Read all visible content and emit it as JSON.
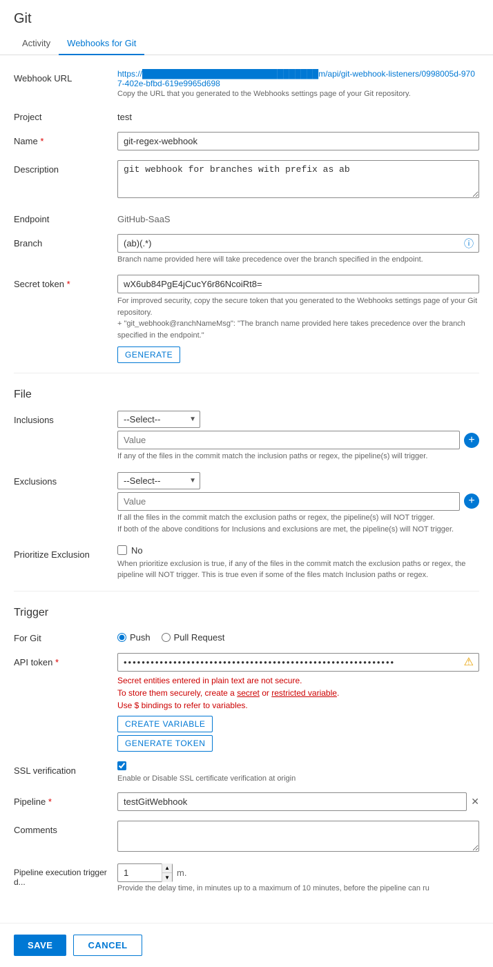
{
  "page": {
    "title": "Git"
  },
  "tabs": [
    {
      "id": "activity",
      "label": "Activity",
      "active": false
    },
    {
      "id": "webhooks",
      "label": "Webhooks for Git",
      "active": true
    }
  ],
  "form": {
    "webhook_url": {
      "label": "Webhook URL",
      "value": "https://██████████████████████████████m/api/git-webhook-listeners/0998005d-9707-402e-bfbd-619e9965d698",
      "hint": "Copy the URL that you generated to the Webhooks settings page of your Git repository."
    },
    "project": {
      "label": "Project",
      "value": "test"
    },
    "name": {
      "label": "Name",
      "required": true,
      "value": "git-regex-webhook"
    },
    "description": {
      "label": "Description",
      "value": "git webhook for branches with prefix as ab"
    },
    "endpoint": {
      "label": "Endpoint",
      "value": "GitHub-SaaS"
    },
    "branch": {
      "label": "Branch",
      "value": "(ab)(.*)",
      "hint": "Branch name provided here will take precedence over the branch specified in the endpoint."
    },
    "secret_token": {
      "label": "Secret token",
      "required": true,
      "value": "wX6ub84PgE4jCucY6r86NcoiRt8=",
      "hints": [
        "For improved security, copy the secure token that you generated to the Webhooks settings page of your Git repository.",
        "+ \"git_webhook@ranchNameMsg\": \"The branch name provided here takes precedence over the branch specified in the endpoint.\""
      ],
      "generate_label": "GENERATE"
    },
    "file_section": "File",
    "inclusions": {
      "label": "Inclusions",
      "select_value": "--Select--",
      "value_placeholder": "Value",
      "hint": "If any of the files in the commit match the inclusion paths or regex, the pipeline(s) will trigger."
    },
    "exclusions": {
      "label": "Exclusions",
      "select_value": "--Select--",
      "value_placeholder": "Value",
      "hints": [
        "If all the files in the commit match the exclusion paths or regex, the pipeline(s) will NOT trigger.",
        "If both of the above conditions for Inclusions and exclusions are met, the pipeline(s) will NOT trigger."
      ]
    },
    "prioritize_exclusion": {
      "label": "Prioritize Exclusion",
      "checked": false,
      "checkbox_label": "No",
      "hint": "When prioritize exclusion is true, if any of the files in the commit match the exclusion paths or regex, the pipeline will NOT trigger. This is true even if some of the files match Inclusion paths or regex."
    },
    "trigger_section": "Trigger",
    "for_git": {
      "label": "For Git",
      "options": [
        "Push",
        "Pull Request"
      ],
      "selected": "Push"
    },
    "api_token": {
      "label": "API token",
      "required": true,
      "value": "••••••••••••••••••••••••••••••••••••••••••••••••••••••••••••",
      "error_lines": [
        "Secret entities entered in plain text are not secure.",
        "To store them securely, create a secret or restricted variable.",
        "Use $ bindings to refer to variables."
      ],
      "create_variable_label": "CREATE VARIABLE",
      "generate_token_label": "GENERATE TOKEN"
    },
    "ssl_verification": {
      "label": "SSL verification",
      "checked": true,
      "hint": "Enable or Disable SSL certificate verification at origin"
    },
    "pipeline": {
      "label": "Pipeline",
      "required": true,
      "value": "testGitWebhook"
    },
    "comments": {
      "label": "Comments",
      "value": ""
    },
    "pipeline_execution_trigger_delay": {
      "label": "Pipeline execution trigger d...",
      "value": "1",
      "unit": "m.",
      "hint": "Provide the delay time, in minutes up to a maximum of 10 minutes, before the pipeline can ru"
    }
  },
  "footer": {
    "save_label": "SAVE",
    "cancel_label": "CANCEL"
  }
}
